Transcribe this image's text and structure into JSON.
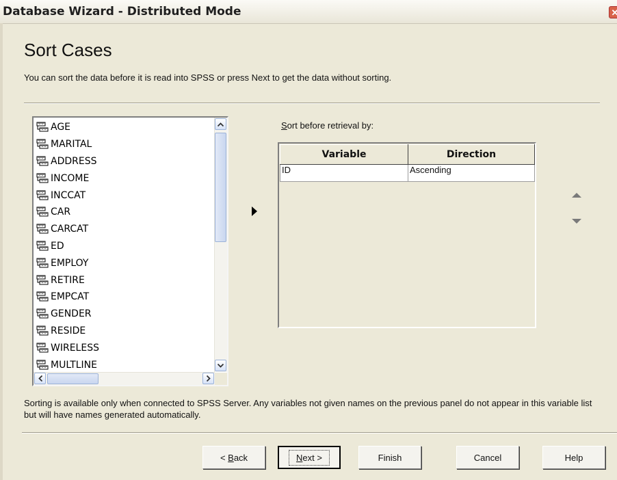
{
  "window": {
    "title": "Database Wizard - Distributed Mode",
    "close_glyph": "✕"
  },
  "header": {
    "title": "Sort Cases",
    "subtitle": "You can sort the data before it is read into SPSS or press Next to get the data without sorting."
  },
  "variables": {
    "items": [
      "AGE",
      "MARITAL",
      "ADDRESS",
      "INCOME",
      "INCCAT",
      "CAR",
      "CARCAT",
      "ED",
      "EMPLOY",
      "RETIRE",
      "EMPCAT",
      "GENDER",
      "RESIDE",
      "WIRELESS",
      "MULTLINE"
    ],
    "icon": "variable-ruler-icon"
  },
  "sort": {
    "label_mnemonic": "S",
    "label_rest": "ort before retrieval by:",
    "columns": [
      "Variable",
      "Direction"
    ],
    "rows": [
      {
        "variable": "ID",
        "direction": "Ascending"
      }
    ]
  },
  "note": "Sorting is available only when connected to SPSS Server. Any variables not given names on the previous panel do not appear in this variable list but will have names generated automatically.",
  "buttons": {
    "back_prefix": "< ",
    "back_mnemonic": "B",
    "back_rest": "ack",
    "next_mnemonic": "N",
    "next_rest": "ext >",
    "finish": "Finish",
    "cancel": "Cancel",
    "help": "Help"
  }
}
